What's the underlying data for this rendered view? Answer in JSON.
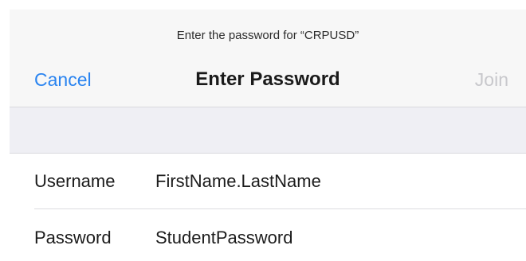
{
  "dialog": {
    "prompt": "Enter the password for “CRPUSD”",
    "title": "Enter Password",
    "cancel_label": "Cancel",
    "join_label": "Join"
  },
  "form": {
    "username": {
      "label": "Username",
      "value": "FirstName.LastName"
    },
    "password": {
      "label": "Password",
      "value": "StudentPassword"
    }
  },
  "colors": {
    "accent": "#2a84f0",
    "disabled": "#c8c8cc",
    "nav_background": "#f7f7f7",
    "section_background": "#efeff4"
  }
}
